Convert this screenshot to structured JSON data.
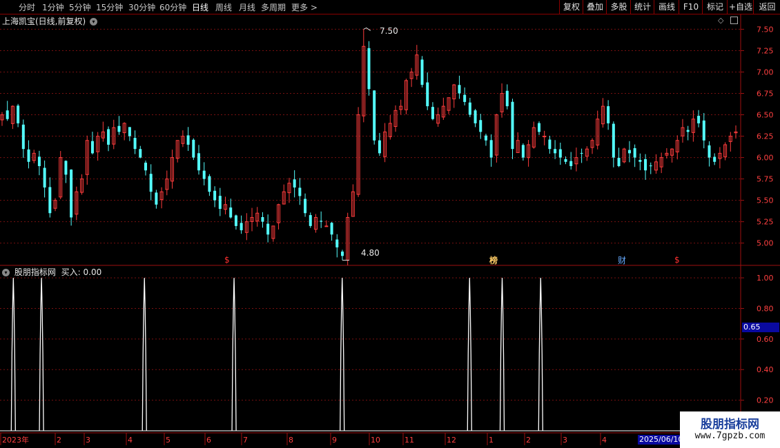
{
  "toolbar": {
    "periods": [
      "分时",
      "1分钟",
      "5分钟",
      "15分钟",
      "30分钟",
      "60分钟",
      "日线",
      "周线",
      "月线",
      "多周期",
      "更多 >"
    ],
    "active_period": "日线",
    "right_buttons": [
      "复权",
      "叠加",
      "多股",
      "统计",
      "画线",
      "F10",
      "标记",
      "+自选",
      "返回"
    ]
  },
  "main_panel": {
    "title": "上海凯宝(日线,前复权)",
    "high_label": "7.50",
    "low_label": "4.80",
    "markers": [
      {
        "text": "$",
        "color": "#ff3030"
      },
      {
        "text": "榜",
        "color": "#ffcc66"
      },
      {
        "text": "财",
        "color": "#66aaff"
      },
      {
        "text": "$",
        "color": "#ff3030"
      }
    ]
  },
  "indicator_panel": {
    "title": "股朋指标网",
    "value_label": "买入: 0.00",
    "current_value": "0.65"
  },
  "xaxis": {
    "labels": [
      "2023年",
      "2",
      "3",
      "4",
      "5",
      "6",
      "7",
      "8",
      "9",
      "10",
      "11",
      "12",
      "1",
      "2",
      "3",
      "4"
    ],
    "date_box": "2025/06/10"
  },
  "watermark": {
    "line1": "股朋指标网",
    "line2": "www.7gpzb.com"
  },
  "colors": {
    "up": "#ff3c3c",
    "down": "#54ffff",
    "grid": "#7a1010",
    "axis_text": "#ff4040",
    "indicator_line": "#ffffff"
  },
  "chart_data": [
    {
      "type": "candlestick",
      "title": "上海凯宝(日线,前复权)",
      "ylim": [
        4.78,
        7.6
      ],
      "yticks": [
        5.0,
        5.25,
        5.5,
        5.75,
        6.0,
        6.25,
        6.5,
        6.75,
        7.0,
        7.25,
        7.5
      ],
      "max": 7.5,
      "min": 4.8,
      "close_series": [
        6.5,
        6.45,
        6.6,
        6.4,
        6.1,
        5.95,
        6.05,
        5.9,
        5.65,
        5.35,
        5.5,
        6.0,
        5.8,
        5.3,
        5.6,
        5.75,
        6.2,
        6.05,
        6.25,
        6.3,
        6.15,
        6.35,
        6.3,
        6.4,
        6.25,
        6.1,
        6.0,
        5.85,
        5.6,
        5.45,
        5.6,
        5.75,
        6.0,
        6.2,
        6.25,
        6.15,
        6.0,
        5.85,
        5.75,
        5.6,
        5.5,
        5.4,
        5.45,
        5.3,
        5.2,
        5.15,
        5.25,
        5.3,
        5.35,
        5.25,
        5.1,
        5.2,
        5.45,
        5.6,
        5.7,
        5.65,
        5.55,
        5.35,
        5.2,
        5.3,
        5.25,
        5.2,
        5.1,
        4.95,
        4.85,
        5.3,
        5.6,
        6.5,
        7.3,
        6.8,
        6.2,
        6.05,
        6.3,
        6.4,
        6.55,
        6.6,
        6.9,
        7.0,
        7.2,
        6.85,
        6.6,
        6.45,
        6.5,
        6.6,
        6.7,
        6.85,
        6.75,
        6.65,
        6.5,
        6.4,
        6.3,
        6.2,
        6.0,
        6.5,
        6.75,
        6.6,
        6.1,
        6.2,
        6.0,
        6.15,
        6.35,
        6.3,
        6.25,
        6.1,
        6.05,
        6.0,
        5.95,
        5.9,
        6.0,
        6.05,
        6.1,
        6.2,
        6.45,
        6.6,
        6.4,
        6.0,
        5.9,
        6.1,
        6.05,
        6.0,
        5.95,
        5.85,
        5.9,
        5.95,
        6.0,
        6.05,
        6.1,
        6.2,
        6.35,
        6.3,
        6.45,
        6.4,
        6.2,
        6.0,
        5.95,
        6.05,
        6.15,
        6.25,
        6.3
      ]
    },
    {
      "type": "line",
      "title": "股朋指标网",
      "ylim": [
        0.0,
        1.05
      ],
      "yticks": [
        0.2,
        0.4,
        0.6,
        0.8,
        1.0
      ],
      "spikes_at_fraction": [
        0.018,
        0.056,
        0.195,
        0.316,
        0.462,
        0.634,
        0.678,
        0.73
      ],
      "spike_value": 1.0,
      "baseline": 0.0
    }
  ]
}
